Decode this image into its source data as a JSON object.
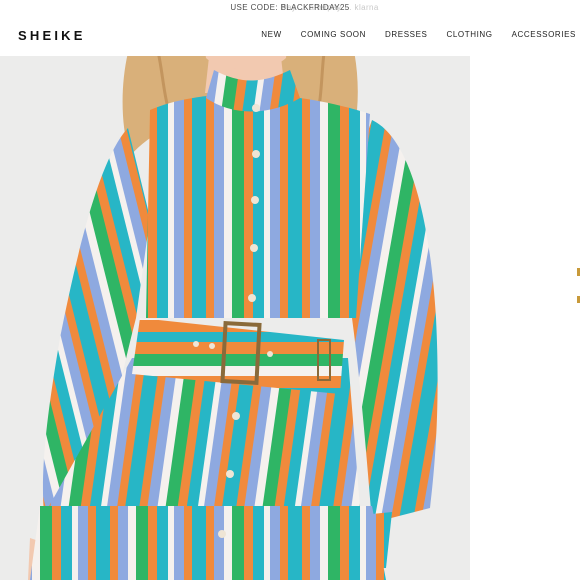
{
  "promo": {
    "text": "USE CODE: BLACKFRIDAY25",
    "ghost_text": "Pay ... afterpay ... klarna"
  },
  "header": {
    "logo": "SHEIKE",
    "nav": [
      {
        "label": "NEW"
      },
      {
        "label": "COMING SOON"
      },
      {
        "label": "DRESSES"
      },
      {
        "label": "CLOTHING"
      },
      {
        "label": "ACCESSORIES"
      }
    ]
  },
  "hero": {
    "image": "model-in-striped-belted-dress",
    "palette": {
      "turquoise": "#27b6c6",
      "orange": "#f08a3c",
      "green": "#2fb565",
      "periwinkle": "#8ea9e0",
      "white": "#f5f1ee",
      "skin": "#f2c9b0",
      "hair": "#d9b07a"
    }
  }
}
